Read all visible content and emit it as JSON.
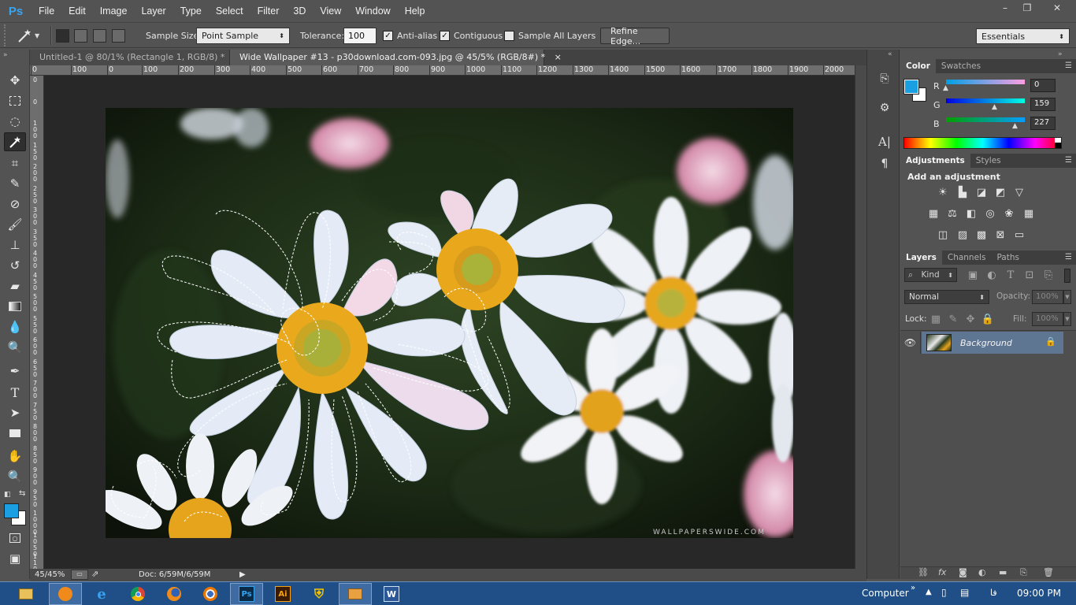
{
  "app": {
    "logo": "Ps"
  },
  "menu": [
    "File",
    "Edit",
    "Image",
    "Layer",
    "Type",
    "Select",
    "Filter",
    "3D",
    "View",
    "Window",
    "Help"
  ],
  "window_controls": {
    "minimize": "–",
    "restore": "❐",
    "close": "✕"
  },
  "options": {
    "sample_size_label": "Sample Size:",
    "sample_size_value": "Point Sample",
    "tolerance_label": "Tolerance:",
    "tolerance_value": "100",
    "anti_alias_label": "Anti-alias",
    "anti_alias_checked": true,
    "contiguous_label": "Contiguous",
    "contiguous_checked": true,
    "sample_all_layers_label": "Sample All Layers",
    "sample_all_layers_checked": false,
    "refine_edge_label": "Refine Edge...",
    "workspace_value": "Essentials"
  },
  "tabs": [
    {
      "title": "Untitled-1 @ 80/1% (Rectangle 1, RGB/8) *",
      "close": "×"
    },
    {
      "title": "Wide Wallpaper #13 - p30download.com-093.jpg @ 45/5% (RGB/8#) *",
      "close": "×",
      "active": true
    }
  ],
  "ruler_top_labels": [
    "0",
    "100",
    "0",
    "100",
    "200",
    "300",
    "400",
    "500",
    "600",
    "700",
    "800",
    "900",
    "1000",
    "1100",
    "1200",
    "1300",
    "1400",
    "1500",
    "1600",
    "1700",
    "1800",
    "1900",
    "2000"
  ],
  "ruler_left_labels": [
    "0",
    "0",
    "1 0 0",
    "1 5 0",
    "2 0 0",
    "2 5 0",
    "3 0 0",
    "3 5 0",
    "4 0 0",
    "4 5 0",
    "5 0 0",
    "5 5 0",
    "6 0 0",
    "6 5 0",
    "7 0 0",
    "7 5 0",
    "8 0 0",
    "8 5 0",
    "9 0 0",
    "9 5 0",
    "1 0 0 0",
    "1 0 5 0",
    "1 1 0 0"
  ],
  "image": {
    "watermark": "WALLPAPERSWIDE.COM"
  },
  "status": {
    "zoom": "45/45%",
    "doc_info": "Doc: 6/59M/6/59M",
    "arrow": "▶"
  },
  "color_panel": {
    "tabs": [
      "Color",
      "Swatches"
    ],
    "fg_color": "#1b9fe3",
    "bg_color": "#ffffff",
    "channels": [
      {
        "label": "R",
        "value": "0",
        "fraction": 0.0
      },
      {
        "label": "G",
        "value": "159",
        "fraction": 0.62
      },
      {
        "label": "B",
        "value": "227",
        "fraction": 0.89
      }
    ]
  },
  "adjustments_panel": {
    "tabs": [
      "Adjustments",
      "Styles"
    ],
    "heading": "Add an adjustment"
  },
  "layers_panel": {
    "tabs": [
      "Layers",
      "Channels",
      "Paths"
    ],
    "kind_label": "Kind",
    "blend_mode": "Normal",
    "opacity_label": "Opacity:",
    "opacity_value": "100%",
    "lock_label": "Lock:",
    "fill_label": "Fill:",
    "fill_value": "100%",
    "layers": [
      {
        "name": "Background",
        "visible": true,
        "locked": true
      }
    ]
  },
  "taskbar": {
    "items": [
      "explorer",
      "media-player",
      "internet-explorer",
      "chrome",
      "firefox",
      "blender",
      "photoshop",
      "illustrator",
      "norton",
      "network-drive",
      "word"
    ],
    "ps_label": "Ps",
    "ai_label": "Ai",
    "word_label": "W",
    "computer_label": "Computer",
    "lang": "فا",
    "time": "09:00 PM"
  },
  "colors": {
    "accent": "#1b9fe3",
    "selection_ants": "#ffffff"
  }
}
